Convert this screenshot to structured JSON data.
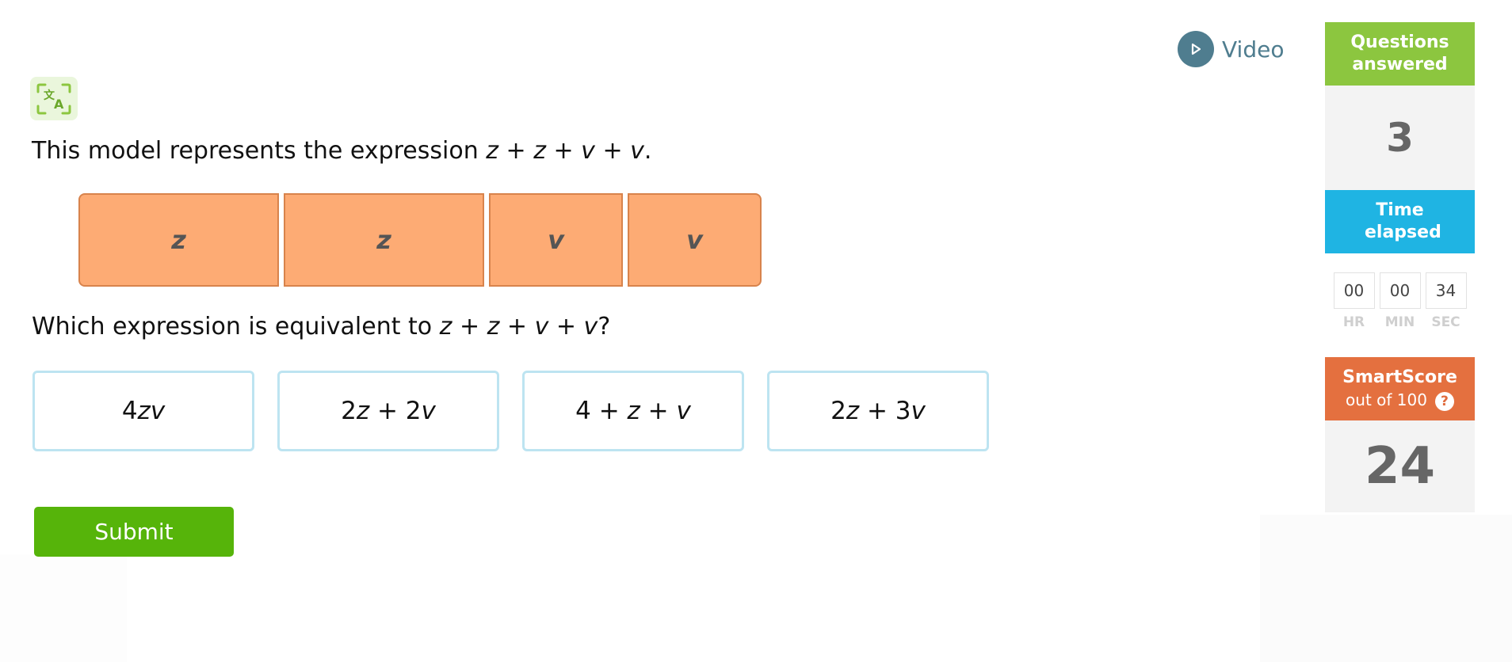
{
  "video": {
    "label": "Video",
    "icon": "play-icon"
  },
  "translate": {
    "icon": "translate-icon"
  },
  "question": {
    "intro_text": "This model represents the expression ",
    "intro_expr": "z + z + v + v",
    "intro_end": ".",
    "model_blocks": [
      "z",
      "z",
      "v",
      "v"
    ],
    "ask_text": "Which expression is equivalent to ",
    "ask_expr": "z + z + v + v",
    "ask_end": "?"
  },
  "choices": [
    {
      "a": "4",
      "b": "zv",
      "c": "",
      "d": ""
    },
    {
      "a": "2",
      "b": "z",
      "c": " + 2",
      "d": "v"
    },
    {
      "a": "4 + ",
      "b": "z",
      "c": " + ",
      "d": "v"
    },
    {
      "a": "2",
      "b": "z",
      "c": " + 3",
      "d": "v"
    }
  ],
  "submit_label": "Submit",
  "sidebar": {
    "questions_answered_label": "Questions answered",
    "questions_answered_value": "3",
    "time_elapsed_label": "Time elapsed",
    "timer": [
      {
        "value": "00",
        "unit": "HR"
      },
      {
        "value": "00",
        "unit": "MIN"
      },
      {
        "value": "34",
        "unit": "SEC"
      }
    ],
    "smartscore_label": "SmartScore",
    "smartscore_sub": "out of 100",
    "smartscore_help": "?",
    "smartscore_value": "24"
  },
  "colors": {
    "green_header": "#8cc63f",
    "blue_header": "#1fb4e3",
    "orange_header": "#e4703f",
    "block_fill": "#fdab74",
    "submit": "#56b40a"
  }
}
